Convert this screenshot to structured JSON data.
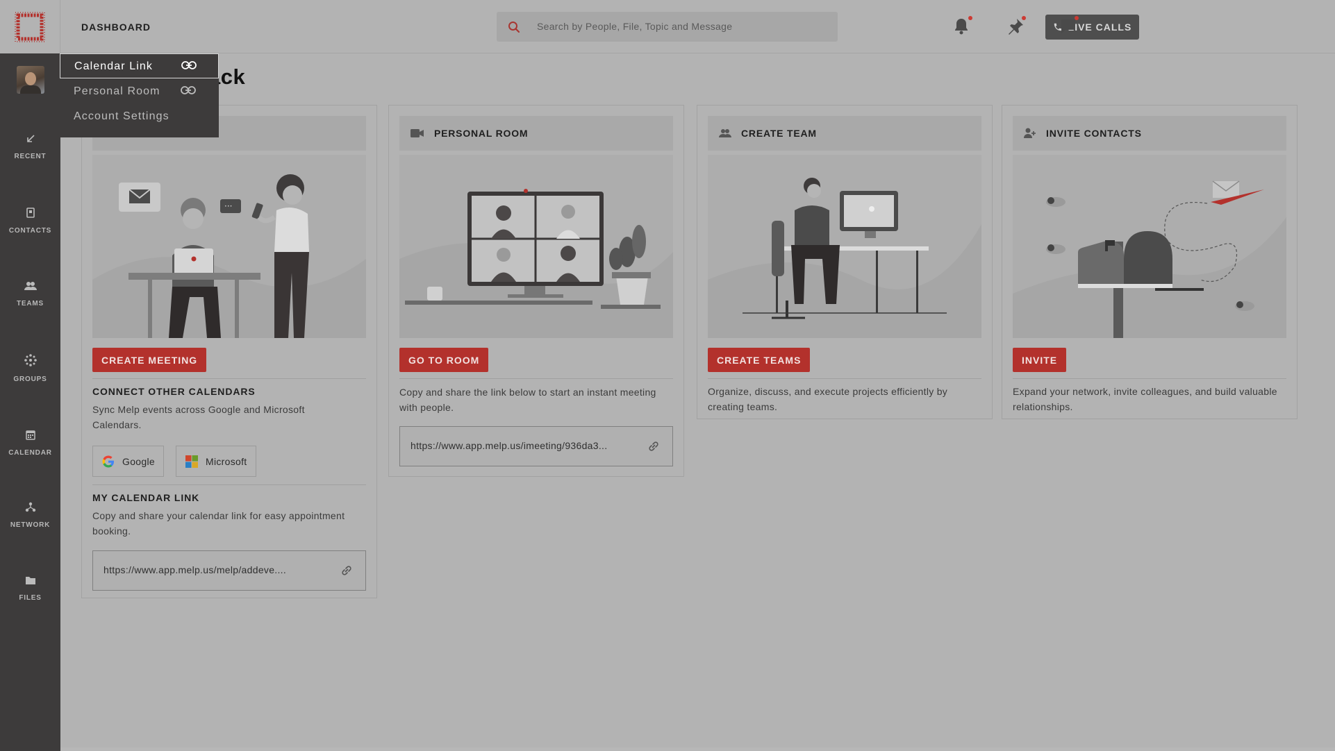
{
  "header": {
    "title": "DASHBOARD",
    "search_placeholder": "Search by People, File, Topic and Message",
    "live_calls_label": "LIVE CALLS",
    "icons": [
      "bell-icon",
      "pin-icon",
      "chat-icon"
    ]
  },
  "sidebar": {
    "items": [
      {
        "label": "RECENT",
        "icon": "recent-icon"
      },
      {
        "label": "CONTACTS",
        "icon": "contacts-icon"
      },
      {
        "label": "TEAMS",
        "icon": "teams-icon"
      },
      {
        "label": "GROUPS",
        "icon": "groups-icon"
      },
      {
        "label": "CALENDAR",
        "icon": "calendar-icon"
      },
      {
        "label": "NETWORK",
        "icon": "network-icon"
      },
      {
        "label": "FILES",
        "icon": "files-icon"
      }
    ]
  },
  "dropdown": {
    "items": [
      {
        "label": "Calendar Link",
        "icon": "link-icon",
        "active": true
      },
      {
        "label": "Personal Room",
        "icon": "link-icon",
        "active": false
      },
      {
        "label": "Account Settings",
        "active": false
      }
    ]
  },
  "page": {
    "heading_visible": "ack"
  },
  "cards": {
    "meeting": {
      "button": "CREATE MEETING",
      "connect_title": "CONNECT OTHER CALENDARS",
      "connect_desc": "Sync Melp events across Google and Microsoft Calendars.",
      "google_label": "Google",
      "microsoft_label": "Microsoft",
      "link_title": "MY CALENDAR LINK",
      "link_desc": "Copy and share your calendar link for easy appointment booking.",
      "link_url": "https://www.app.melp.us/melp/addeve...."
    },
    "room": {
      "title": "PERSONAL ROOM",
      "button": "GO TO ROOM",
      "desc": "Copy and share the link below to start an instant meeting with people.",
      "link_url": "https://www.app.melp.us/imeeting/936da3..."
    },
    "team": {
      "title": "CREATE TEAM",
      "button": "CREATE TEAMS",
      "desc": "Organize, discuss, and execute projects efficiently by creating teams."
    },
    "invite": {
      "title": "INVITE CONTACTS",
      "button": "INVITE",
      "desc": "Expand your network, invite colleagues, and build valuable relationships."
    }
  },
  "colors": {
    "accent_red": "#b3312c",
    "sidebar_bg": "#3d3b3b",
    "overlay_bg": "#b3b3b3"
  }
}
